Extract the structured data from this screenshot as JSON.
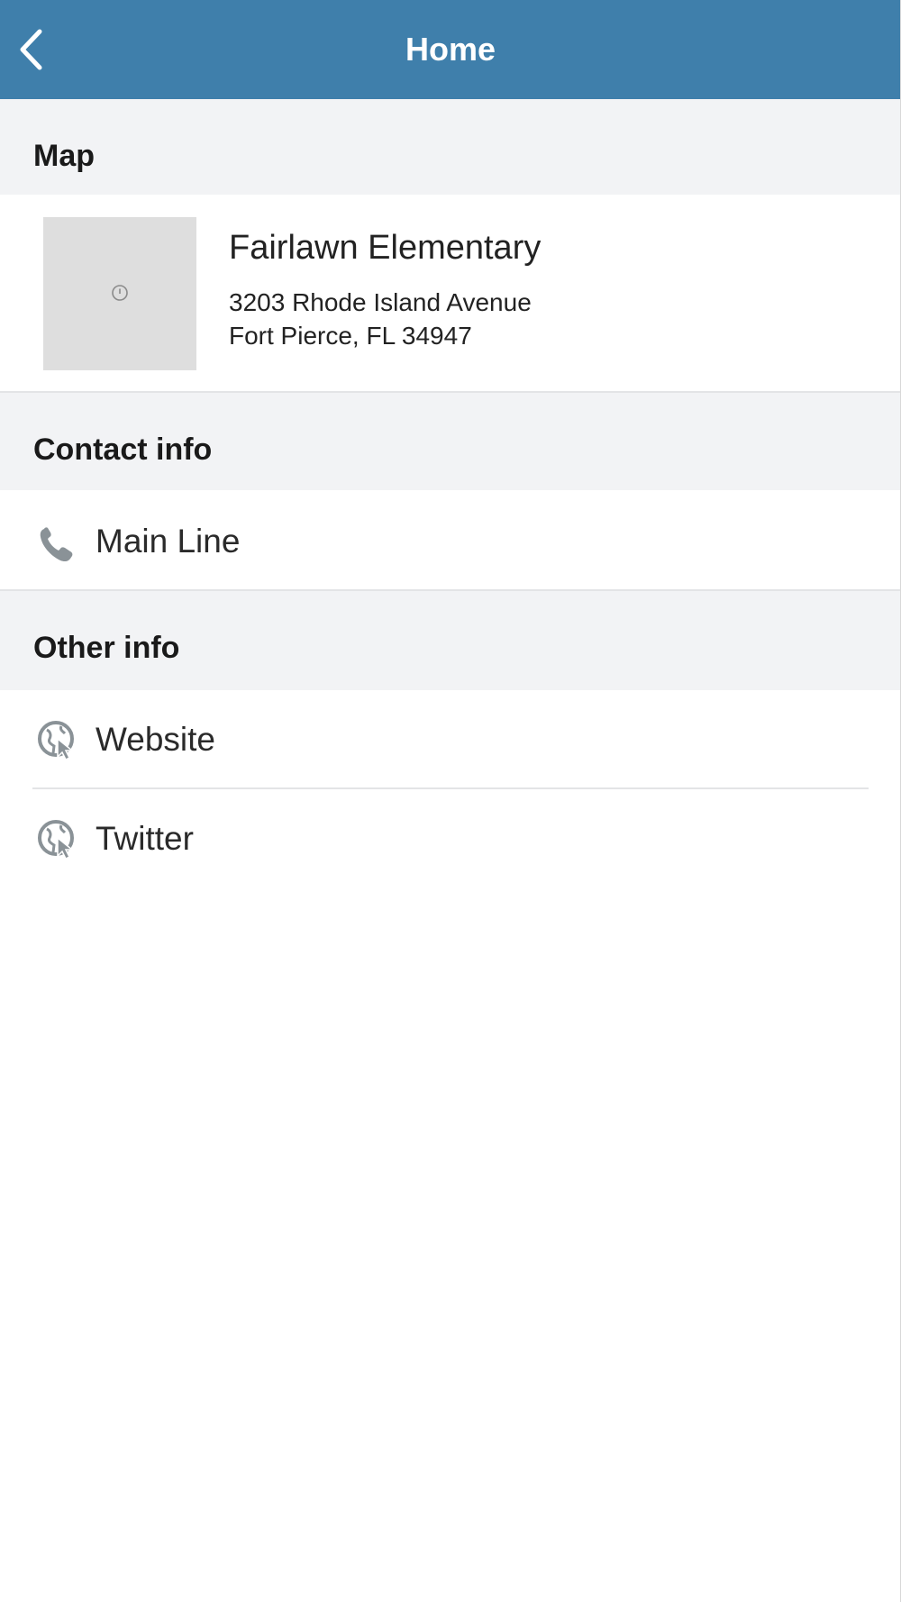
{
  "header": {
    "title": "Home",
    "background": "#3f7fab",
    "back_icon": "chevron-left-icon"
  },
  "sections": {
    "map": {
      "label": "Map",
      "place_name": "Fairlawn Elementary",
      "address_line1": "3203 Rhode Island Avenue",
      "address_line2": "Fort Pierce, FL 34947",
      "thumbnail_icon": "map-pin-icon"
    },
    "contact": {
      "label": "Contact info",
      "items": [
        {
          "label": "Main Line",
          "icon": "phone-icon"
        }
      ]
    },
    "other": {
      "label": "Other info",
      "items": [
        {
          "label": "Website",
          "icon": "globe-cursor-icon"
        },
        {
          "label": "Twitter",
          "icon": "globe-cursor-icon"
        }
      ]
    }
  },
  "colors": {
    "section_background": "#f2f3f5",
    "divider": "#e3e4e6",
    "icon_gray": "#8a9297"
  }
}
